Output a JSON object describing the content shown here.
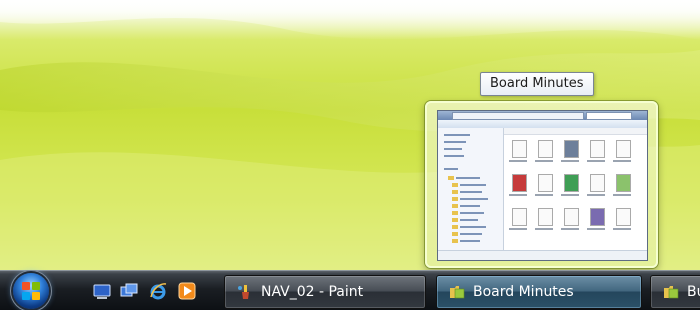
{
  "tooltip": {
    "title": "Board Minutes"
  },
  "taskbar": {
    "start_button": "start-orb",
    "quick_launch": [
      {
        "name": "show-desktop-icon"
      },
      {
        "name": "switch-windows-icon"
      },
      {
        "name": "internet-explorer-icon"
      },
      {
        "name": "media-player-icon"
      }
    ],
    "tasks": [
      {
        "label": "NAV_02 - Paint",
        "icon": "paint-icon",
        "active": false
      },
      {
        "label": "Board Minutes",
        "icon": "folder-icon",
        "active": true
      },
      {
        "label": "Bu",
        "icon": "folder-icon",
        "active": false
      }
    ]
  },
  "colors": {
    "desktop_lime": "#c8df3a",
    "taskbar_dark": "#1a1e23",
    "active_task": "#42677f"
  }
}
